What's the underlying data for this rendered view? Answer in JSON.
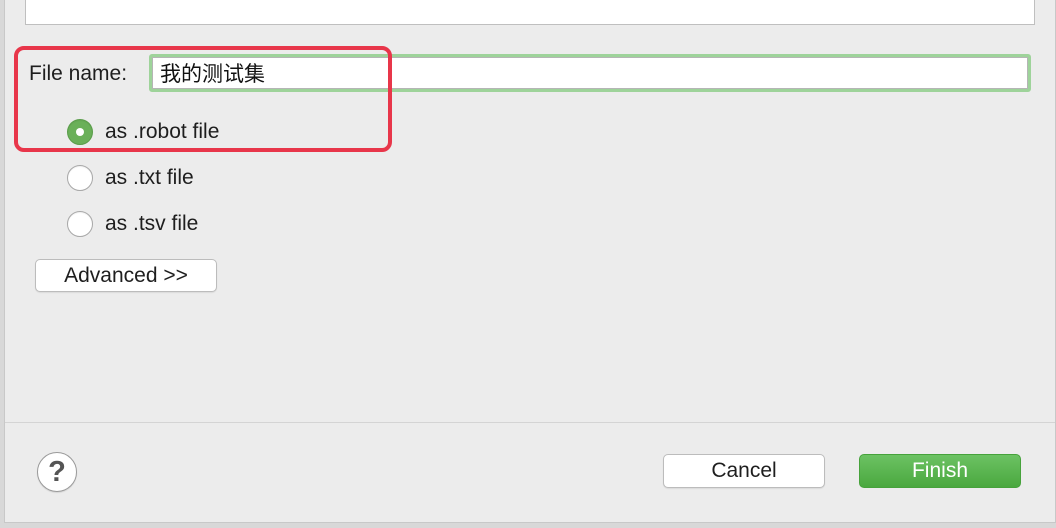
{
  "form": {
    "file_name_label": "File name:",
    "file_name_value": "我的测试集"
  },
  "format_options": [
    {
      "label": "as .robot file",
      "checked": true
    },
    {
      "label": "as .txt file",
      "checked": false
    },
    {
      "label": "as .tsv file",
      "checked": false
    }
  ],
  "buttons": {
    "advanced": "Advanced >>",
    "help": "?",
    "cancel": "Cancel",
    "finish": "Finish"
  },
  "colors": {
    "accent_green": "#5aae4e",
    "input_focus_ring": "#9ed39a",
    "annotation_red": "#e8364a"
  }
}
